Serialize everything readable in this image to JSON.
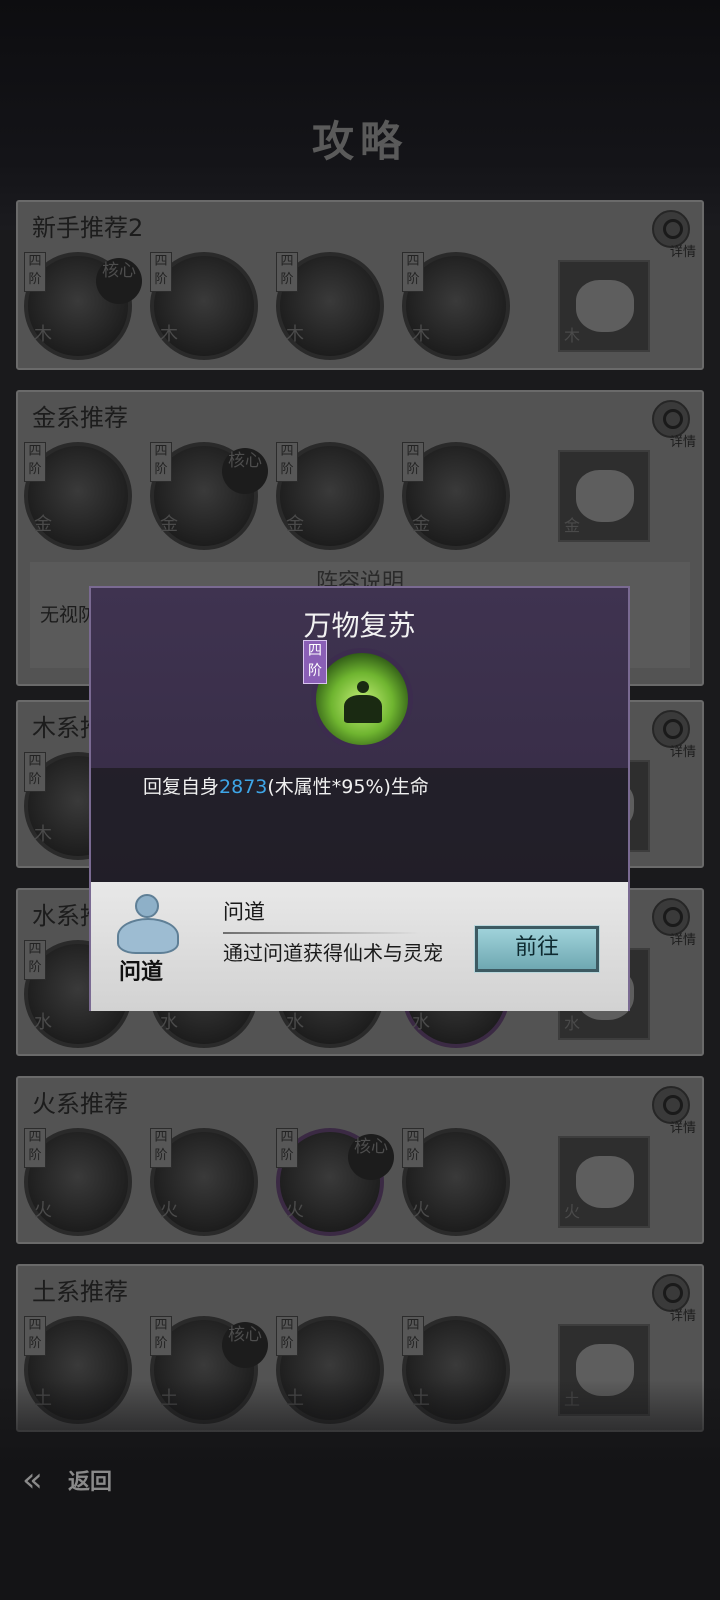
{
  "header": {
    "title": "攻略"
  },
  "common": {
    "tier_label": "四阶",
    "core_label": "核心",
    "detail_label": "详情"
  },
  "cards": [
    {
      "title": "新手推荐2",
      "elem": "木",
      "core_index": 0,
      "pet_elem": "木"
    },
    {
      "title": "金系推荐",
      "elem": "金",
      "core_index": 1,
      "pet_elem": "金",
      "desc_title": "阵容说明",
      "desc_text": "无视防御以及削弱回复，最大程度击破对防守阵容进行打击"
    },
    {
      "title": "木系推荐",
      "elem": "木",
      "core_index": 0,
      "pet_elem": "木"
    },
    {
      "title": "水系推荐",
      "elem": "水",
      "core_index": -1,
      "pet_elem": "水"
    },
    {
      "title": "火系推荐",
      "elem": "火",
      "core_index": 2,
      "pet_elem": "火"
    },
    {
      "title": "土系推荐",
      "elem": "土",
      "core_index": 1,
      "pet_elem": "土"
    }
  ],
  "popup": {
    "title": "万物复苏",
    "tier": "四阶",
    "desc_prefix": "回复自身",
    "desc_value": "2873",
    "desc_suffix": "(木属性*95%)生命",
    "source": {
      "icon_label": "问道",
      "title": "问道",
      "desc": "通过问道获得仙术与灵宠",
      "button": "前往"
    }
  },
  "footer": {
    "back_label": "返回"
  },
  "colors": {
    "accent_blue": "#3ea6e8",
    "popup_border": "#7a6a92",
    "button": "#8ec4cc"
  }
}
